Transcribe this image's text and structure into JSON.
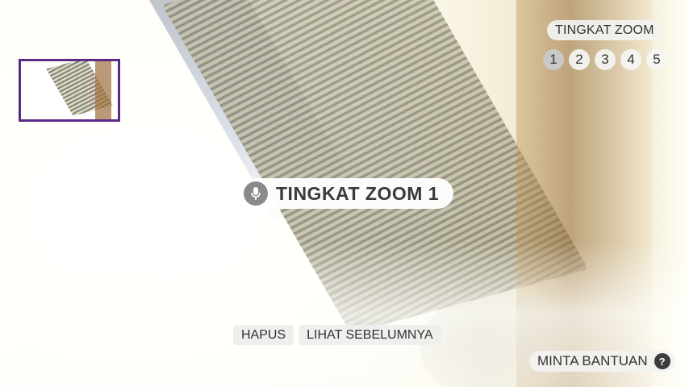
{
  "zoom": {
    "label": "TINGKAT ZOOM",
    "levels": [
      "1",
      "2",
      "3",
      "4",
      "5"
    ],
    "active_level": "1"
  },
  "status": {
    "text": "TINGKAT ZOOM 1",
    "icon": "microphone-icon"
  },
  "actions": {
    "delete_label": "HAPUS",
    "previous_label": "LIHAT SEBELUMNYA"
  },
  "help": {
    "label": "MINTA BANTUAN",
    "icon_glyph": "?"
  },
  "colors": {
    "thumbnail_border": "#5a2a86",
    "active_level_bg": "#c9c9c7"
  }
}
